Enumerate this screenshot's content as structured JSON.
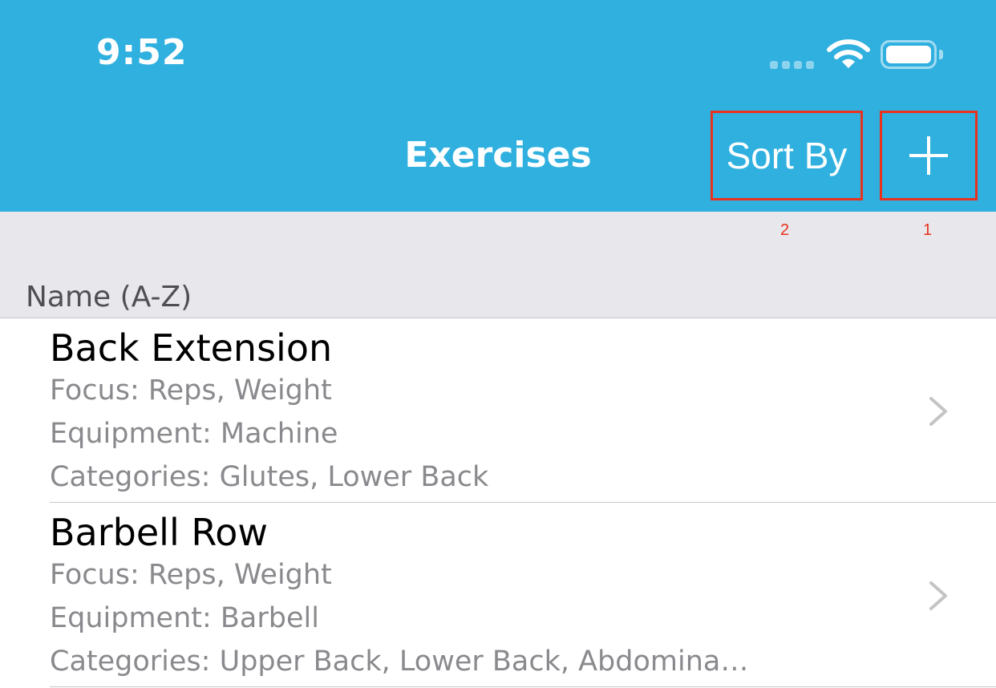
{
  "status_bar": {
    "time": "9:52",
    "signal_icon": "cellular-signal-icon",
    "wifi_icon": "wifi-icon",
    "battery_icon": "battery-icon"
  },
  "nav": {
    "title": "Exercises",
    "sort_label": "Sort By",
    "add_icon": "plus-icon"
  },
  "markers": [
    "2",
    "1"
  ],
  "section": {
    "header": "Name (A-Z)"
  },
  "exercises": [
    {
      "name": "Back Extension",
      "focus": "Focus: Reps, Weight",
      "equipment": "Equipment: Machine",
      "categories": "Categories: Glutes, Lower Back"
    },
    {
      "name": "Barbell Row",
      "focus": "Focus: Reps, Weight",
      "equipment": "Equipment: Barbell",
      "categories": "Categories: Upper Back, Lower Back, Abdomina…"
    }
  ],
  "colors": {
    "nav_background": "#2fb0df",
    "highlight_box": "#e8321e",
    "section_background": "#e8e7ec"
  }
}
